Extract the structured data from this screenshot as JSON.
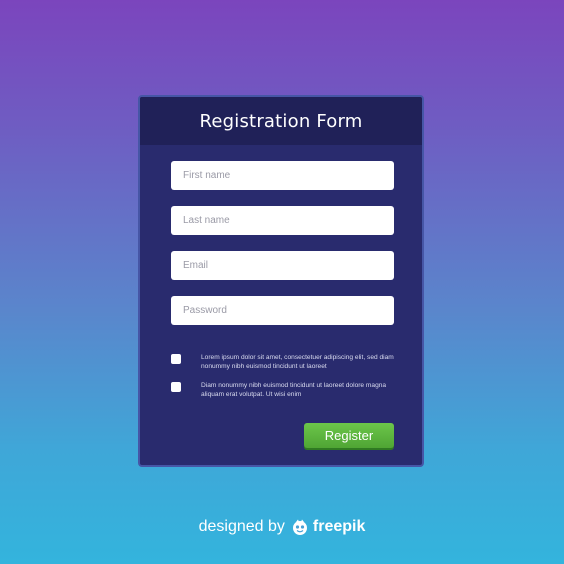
{
  "form": {
    "title": "Registration Form",
    "fields": [
      {
        "placeholder": "First name"
      },
      {
        "placeholder": "Last name"
      },
      {
        "placeholder": "Email"
      },
      {
        "placeholder": "Password"
      }
    ],
    "checks": [
      {
        "text": "Lorem ipsum dolor sit amet, consectetuer adipiscing elit, sed diam nonummy nibh euismod tincidunt ut laoreet"
      },
      {
        "text": "Diam nonummy nibh euismod tincidunt ut laoreet dolore magna aliquam erat volutpat. Ut wisi enim"
      }
    ],
    "register_label": "Register"
  },
  "footer": {
    "designed_by": "designed by",
    "brand": "freepik",
    "logo_icon": "freepik-logo-icon"
  },
  "colors": {
    "card_bg": "#292b6e",
    "header_bg": "#202158",
    "button_green": "#5cb53e"
  }
}
